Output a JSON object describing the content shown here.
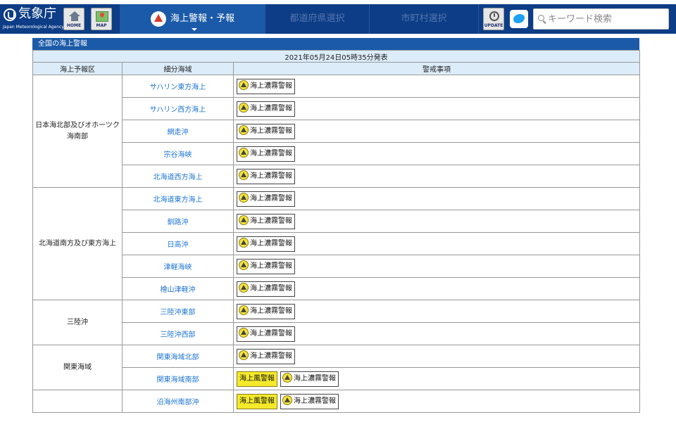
{
  "header": {
    "logo_text": "気象庁",
    "logo_sub": "Japan Meteorological Agency",
    "home_label": "HOME",
    "map_label": "MAP",
    "nav": [
      {
        "label": "海上警報・予報",
        "active": true
      },
      {
        "label": "都道府県選択",
        "active": false
      },
      {
        "label": "市町村選択",
        "active": false
      }
    ],
    "update_label": "UPDATE",
    "search_placeholder": "キーワード検索"
  },
  "panel": {
    "title": "全国の海上警報",
    "issued": "2021年05月24日05時35分発表",
    "columns": [
      "海上予報区",
      "細分海域",
      "警戒事項"
    ],
    "groups": [
      {
        "area": "日本海北部及びオホーツク海南部",
        "rows": [
          {
            "sub": "サハリン東方海上",
            "alerts": [
              "海上濃霧警報"
            ]
          },
          {
            "sub": "サハリン西方海上",
            "alerts": [
              "海上濃霧警報"
            ]
          },
          {
            "sub": "網走沖",
            "alerts": [
              "海上濃霧警報"
            ]
          },
          {
            "sub": "宗谷海峡",
            "alerts": [
              "海上濃霧警報"
            ]
          },
          {
            "sub": "北海道西方海上",
            "alerts": [
              "海上濃霧警報"
            ]
          }
        ]
      },
      {
        "area": "北海道南方及び東方海上",
        "rows": [
          {
            "sub": "北海道東方海上",
            "alerts": [
              "海上濃霧警報"
            ]
          },
          {
            "sub": "釧路沖",
            "alerts": [
              "海上濃霧警報"
            ]
          },
          {
            "sub": "日高沖",
            "alerts": [
              "海上濃霧警報"
            ]
          },
          {
            "sub": "津軽海峡",
            "alerts": [
              "海上濃霧警報"
            ]
          },
          {
            "sub": "檜山津軽沖",
            "alerts": [
              "海上濃霧警報"
            ]
          }
        ]
      },
      {
        "area": "三陸沖",
        "rows": [
          {
            "sub": "三陸沖東部",
            "alerts": [
              "海上濃霧警報"
            ]
          },
          {
            "sub": "三陸沖西部",
            "alerts": [
              "海上濃霧警報"
            ]
          }
        ]
      },
      {
        "area": "関東海域",
        "rows": [
          {
            "sub": "関東海域北部",
            "alerts": [
              "海上濃霧警報"
            ]
          },
          {
            "sub": "関東海域南部",
            "alerts": [
              "海上風警報",
              "海上濃霧警報"
            ]
          }
        ]
      },
      {
        "area": "",
        "rows": [
          {
            "sub": "沿海州南部沖",
            "alerts": [
              "海上風警報",
              "海上濃霧警報"
            ]
          }
        ]
      }
    ]
  }
}
